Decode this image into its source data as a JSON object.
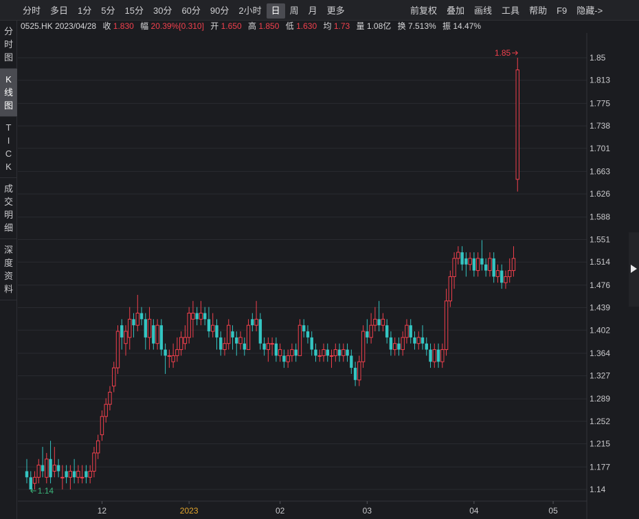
{
  "toolbar": {
    "periods": [
      "分时",
      "多日",
      "1分",
      "5分",
      "15分",
      "30分",
      "60分",
      "90分",
      "2小时",
      "日",
      "周",
      "月",
      "更多"
    ],
    "active_period": "日",
    "tools": [
      "前复权",
      "叠加",
      "画线",
      "工具",
      "帮助",
      "F9",
      "隐藏->"
    ]
  },
  "sidebar": {
    "tabs": [
      {
        "label": [
          "分",
          "时",
          "图"
        ],
        "active": false
      },
      {
        "label": [
          "K",
          "线",
          "图"
        ],
        "active": true
      },
      {
        "label": [
          "T",
          "I",
          "C",
          "K"
        ],
        "active": false
      },
      {
        "label": [
          "成",
          "交",
          "明",
          "细"
        ],
        "active": false
      },
      {
        "label": [
          "深",
          "度",
          "资",
          "料"
        ],
        "active": false
      }
    ]
  },
  "info": {
    "code_date": "0525.HK 2023/04/28",
    "close_label": "收",
    "close": "1.830",
    "amp_label": "幅",
    "amp": "20.39%[0.310]",
    "open_label": "开",
    "open": "1.650",
    "high_label": "高",
    "high": "1.850",
    "low_label": "低",
    "low": "1.630",
    "avg_label": "均",
    "avg": "1.73",
    "vol_label": "量",
    "vol": "1.08亿",
    "turnover_label": "换",
    "turnover": "7.513%",
    "swing_label": "振",
    "swing": "14.47%"
  },
  "chart_data": {
    "type": "candlestick",
    "y_ticks": [
      "1.85",
      "1.813",
      "1.775",
      "1.738",
      "1.701",
      "1.663",
      "1.626",
      "1.588",
      "1.551",
      "1.514",
      "1.476",
      "1.439",
      "1.402",
      "1.364",
      "1.327",
      "1.289",
      "1.252",
      "1.215",
      "1.177",
      "1.14"
    ],
    "ylim": [
      1.14,
      1.85
    ],
    "x_ticks": [
      {
        "label": "12",
        "index": 19
      },
      {
        "label": "2023",
        "index": 41
      },
      {
        "label": "02",
        "index": 64
      },
      {
        "label": "03",
        "index": 86
      },
      {
        "label": "04",
        "index": 113
      },
      {
        "label": "05",
        "index": 133
      }
    ],
    "x_tick_highlight": "2023",
    "high_marker": "1.85",
    "low_marker": "1.14",
    "colors": {
      "up": "#f2404d",
      "down": "#34c5c2",
      "grid": "#2a2b30",
      "axis_text": "#c9c9cc",
      "year_text": "#e2a52c",
      "low_marker": "#3bb57a",
      "background": "#1b1c20"
    },
    "candles": [
      [
        1.17,
        1.16,
        1.19,
        1.15
      ],
      [
        1.16,
        1.14,
        1.17,
        1.14
      ],
      [
        1.15,
        1.16,
        1.17,
        1.14
      ],
      [
        1.16,
        1.18,
        1.19,
        1.15
      ],
      [
        1.18,
        1.17,
        1.21,
        1.16
      ],
      [
        1.16,
        1.19,
        1.2,
        1.15
      ],
      [
        1.19,
        1.16,
        1.22,
        1.15
      ],
      [
        1.17,
        1.18,
        1.21,
        1.16
      ],
      [
        1.18,
        1.17,
        1.19,
        1.16
      ],
      [
        1.16,
        1.16,
        1.18,
        1.14
      ],
      [
        1.17,
        1.16,
        1.18,
        1.15
      ],
      [
        1.16,
        1.17,
        1.18,
        1.14
      ],
      [
        1.17,
        1.16,
        1.19,
        1.15
      ],
      [
        1.16,
        1.17,
        1.18,
        1.15
      ],
      [
        1.16,
        1.16,
        1.18,
        1.15
      ],
      [
        1.17,
        1.16,
        1.18,
        1.15
      ],
      [
        1.16,
        1.17,
        1.18,
        1.15
      ],
      [
        1.17,
        1.2,
        1.21,
        1.16
      ],
      [
        1.2,
        1.22,
        1.23,
        1.19
      ],
      [
        1.23,
        1.26,
        1.27,
        1.22
      ],
      [
        1.26,
        1.28,
        1.29,
        1.25
      ],
      [
        1.28,
        1.3,
        1.31,
        1.27
      ],
      [
        1.31,
        1.34,
        1.35,
        1.3
      ],
      [
        1.34,
        1.4,
        1.41,
        1.33
      ],
      [
        1.41,
        1.39,
        1.42,
        1.37
      ],
      [
        1.38,
        1.4,
        1.41,
        1.36
      ],
      [
        1.39,
        1.42,
        1.44,
        1.37
      ],
      [
        1.42,
        1.41,
        1.43,
        1.39
      ],
      [
        1.41,
        1.43,
        1.46,
        1.4
      ],
      [
        1.43,
        1.42,
        1.44,
        1.41
      ],
      [
        1.42,
        1.39,
        1.43,
        1.37
      ],
      [
        1.39,
        1.42,
        1.44,
        1.37
      ],
      [
        1.41,
        1.38,
        1.42,
        1.37
      ],
      [
        1.38,
        1.41,
        1.42,
        1.37
      ],
      [
        1.41,
        1.37,
        1.42,
        1.36
      ],
      [
        1.37,
        1.36,
        1.38,
        1.33
      ],
      [
        1.36,
        1.36,
        1.37,
        1.34
      ],
      [
        1.35,
        1.36,
        1.38,
        1.34
      ],
      [
        1.36,
        1.37,
        1.39,
        1.35
      ],
      [
        1.37,
        1.39,
        1.4,
        1.36
      ],
      [
        1.38,
        1.39,
        1.41,
        1.37
      ],
      [
        1.39,
        1.43,
        1.44,
        1.38
      ],
      [
        1.42,
        1.43,
        1.45,
        1.39
      ],
      [
        1.43,
        1.42,
        1.44,
        1.41
      ],
      [
        1.42,
        1.43,
        1.45,
        1.41
      ],
      [
        1.43,
        1.42,
        1.44,
        1.41
      ],
      [
        1.42,
        1.4,
        1.44,
        1.39
      ],
      [
        1.4,
        1.41,
        1.43,
        1.39
      ],
      [
        1.41,
        1.39,
        1.42,
        1.37
      ],
      [
        1.39,
        1.37,
        1.4,
        1.36
      ],
      [
        1.37,
        1.38,
        1.39,
        1.36
      ],
      [
        1.38,
        1.41,
        1.42,
        1.37
      ],
      [
        1.4,
        1.39,
        1.41,
        1.37
      ],
      [
        1.39,
        1.38,
        1.4,
        1.36
      ],
      [
        1.38,
        1.39,
        1.4,
        1.37
      ],
      [
        1.38,
        1.37,
        1.39,
        1.36
      ],
      [
        1.37,
        1.41,
        1.42,
        1.37
      ],
      [
        1.42,
        1.41,
        1.43,
        1.4
      ],
      [
        1.41,
        1.42,
        1.45,
        1.4
      ],
      [
        1.42,
        1.38,
        1.43,
        1.37
      ],
      [
        1.38,
        1.37,
        1.39,
        1.36
      ],
      [
        1.37,
        1.38,
        1.39,
        1.35
      ],
      [
        1.38,
        1.38,
        1.39,
        1.36
      ],
      [
        1.38,
        1.36,
        1.39,
        1.35
      ],
      [
        1.36,
        1.37,
        1.38,
        1.35
      ],
      [
        1.36,
        1.35,
        1.37,
        1.34
      ],
      [
        1.35,
        1.36,
        1.37,
        1.34
      ],
      [
        1.36,
        1.37,
        1.38,
        1.35
      ],
      [
        1.37,
        1.36,
        1.38,
        1.35
      ],
      [
        1.36,
        1.41,
        1.42,
        1.36
      ],
      [
        1.41,
        1.4,
        1.42,
        1.39
      ],
      [
        1.4,
        1.39,
        1.41,
        1.38
      ],
      [
        1.39,
        1.37,
        1.4,
        1.36
      ],
      [
        1.37,
        1.36,
        1.38,
        1.35
      ],
      [
        1.36,
        1.36,
        1.37,
        1.35
      ],
      [
        1.36,
        1.37,
        1.38,
        1.35
      ],
      [
        1.37,
        1.36,
        1.38,
        1.35
      ],
      [
        1.36,
        1.36,
        1.37,
        1.34
      ],
      [
        1.36,
        1.37,
        1.38,
        1.35
      ],
      [
        1.37,
        1.36,
        1.38,
        1.35
      ],
      [
        1.36,
        1.37,
        1.38,
        1.35
      ],
      [
        1.37,
        1.36,
        1.38,
        1.35
      ],
      [
        1.36,
        1.34,
        1.37,
        1.33
      ],
      [
        1.34,
        1.32,
        1.35,
        1.31
      ],
      [
        1.32,
        1.35,
        1.36,
        1.31
      ],
      [
        1.35,
        1.4,
        1.41,
        1.34
      ],
      [
        1.4,
        1.39,
        1.42,
        1.38
      ],
      [
        1.39,
        1.41,
        1.43,
        1.38
      ],
      [
        1.41,
        1.42,
        1.44,
        1.4
      ],
      [
        1.42,
        1.41,
        1.45,
        1.4
      ],
      [
        1.41,
        1.42,
        1.43,
        1.4
      ],
      [
        1.41,
        1.39,
        1.42,
        1.38
      ],
      [
        1.39,
        1.37,
        1.4,
        1.36
      ],
      [
        1.37,
        1.38,
        1.39,
        1.36
      ],
      [
        1.38,
        1.37,
        1.39,
        1.36
      ],
      [
        1.37,
        1.39,
        1.4,
        1.36
      ],
      [
        1.39,
        1.41,
        1.42,
        1.38
      ],
      [
        1.41,
        1.39,
        1.42,
        1.38
      ],
      [
        1.39,
        1.38,
        1.4,
        1.37
      ],
      [
        1.38,
        1.39,
        1.4,
        1.37
      ],
      [
        1.39,
        1.38,
        1.41,
        1.37
      ],
      [
        1.38,
        1.37,
        1.39,
        1.36
      ],
      [
        1.37,
        1.35,
        1.38,
        1.34
      ],
      [
        1.35,
        1.37,
        1.38,
        1.34
      ],
      [
        1.37,
        1.35,
        1.38,
        1.34
      ],
      [
        1.35,
        1.37,
        1.38,
        1.34
      ],
      [
        1.37,
        1.45,
        1.47,
        1.36
      ],
      [
        1.45,
        1.49,
        1.5,
        1.44
      ],
      [
        1.49,
        1.52,
        1.53,
        1.47
      ],
      [
        1.52,
        1.53,
        1.54,
        1.51
      ],
      [
        1.53,
        1.51,
        1.54,
        1.5
      ],
      [
        1.52,
        1.51,
        1.53,
        1.49
      ],
      [
        1.51,
        1.52,
        1.53,
        1.5
      ],
      [
        1.52,
        1.5,
        1.53,
        1.49
      ],
      [
        1.5,
        1.52,
        1.53,
        1.49
      ],
      [
        1.52,
        1.51,
        1.55,
        1.5
      ],
      [
        1.51,
        1.5,
        1.52,
        1.49
      ],
      [
        1.5,
        1.52,
        1.53,
        1.49
      ],
      [
        1.52,
        1.49,
        1.53,
        1.48
      ],
      [
        1.49,
        1.5,
        1.51,
        1.48
      ],
      [
        1.5,
        1.48,
        1.51,
        1.47
      ],
      [
        1.48,
        1.49,
        1.5,
        1.47
      ],
      [
        1.49,
        1.5,
        1.52,
        1.48
      ],
      [
        1.5,
        1.52,
        1.54,
        1.49
      ],
      [
        1.65,
        1.83,
        1.85,
        1.63
      ]
    ]
  }
}
